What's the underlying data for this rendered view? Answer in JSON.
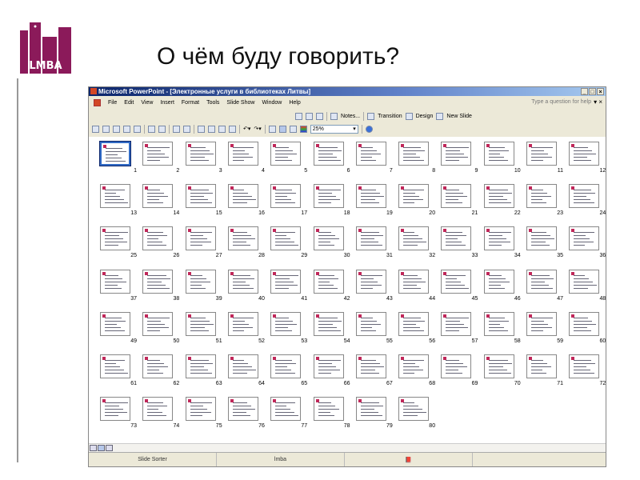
{
  "slide_title": "О чём буду говорить?",
  "logo_text": "LMBA",
  "window": {
    "title": "Microsoft PowerPoint - [Электронные услуги в библиотеках Литвы]",
    "menu": [
      "File",
      "Edit",
      "View",
      "Insert",
      "Format",
      "Tools",
      "Slide Show",
      "Window",
      "Help"
    ],
    "help_placeholder": "Type a question for help",
    "toolbar1": {
      "notes": "Notes...",
      "transition": "Transition",
      "design": "Design",
      "new_slide": "New Slide"
    },
    "zoom": "25%",
    "status": {
      "view": "Slide Sorter",
      "design": "lmba"
    },
    "selected_slide": 1,
    "slide_count": 80
  }
}
